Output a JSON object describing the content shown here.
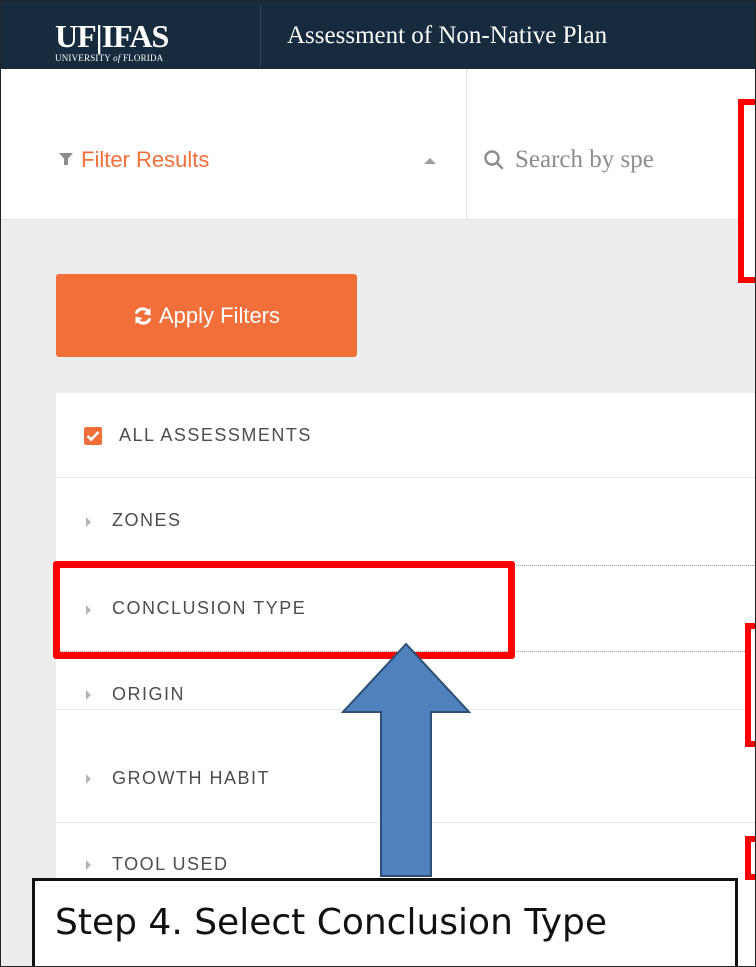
{
  "header": {
    "logo_main": "UF|IFAS",
    "logo_sub_before": "UNIVERSITY ",
    "logo_sub_of": "of",
    "logo_sub_after": " FLORIDA",
    "title": "Assessment of Non-Native Plan"
  },
  "filter_bar": {
    "filter_label": "Filter Results",
    "search_placeholder": "Search by spe"
  },
  "sidebar": {
    "apply_button_label": "Apply Filters",
    "all_assessments": {
      "label": "ALL ASSESSMENTS",
      "checked": true
    },
    "sections": [
      {
        "label": "ZONES"
      },
      {
        "label": "CONCLUSION TYPE"
      },
      {
        "label": "ORIGIN"
      },
      {
        "label": "GROWTH HABIT"
      },
      {
        "label": "TOOL USED"
      }
    ]
  },
  "annotation": {
    "callout_text": "Step 4. Select Conclusion Type",
    "highlight_color": "#ff0000",
    "arrow_color": "#4f81bd"
  },
  "colors": {
    "header_bg": "#162b3d",
    "accent": "#f26f3a",
    "page_bg": "#ededed"
  }
}
